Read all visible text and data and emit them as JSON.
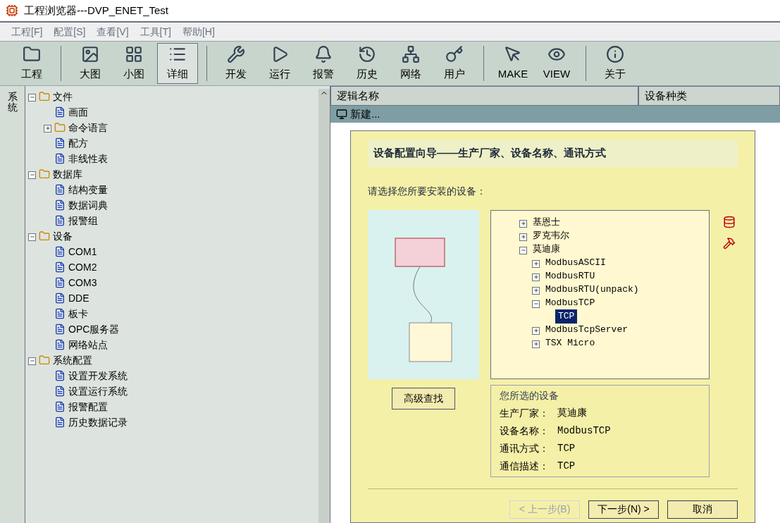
{
  "window": {
    "title": "工程浏览器---DVP_ENET_Test"
  },
  "menu": [
    "工程[F]",
    "配置[S]",
    "查看[V]",
    "工具[T]",
    "帮助[H]"
  ],
  "toolbar": [
    {
      "label": "工程",
      "selected": false
    },
    {
      "label": "大图",
      "selected": false
    },
    {
      "label": "小图",
      "selected": false
    },
    {
      "label": "详细",
      "selected": true
    },
    {
      "label": "开发",
      "selected": false
    },
    {
      "label": "运行",
      "selected": false
    },
    {
      "label": "报警",
      "selected": false
    },
    {
      "label": "历史",
      "selected": false
    },
    {
      "label": "网络",
      "selected": false
    },
    {
      "label": "用户",
      "selected": false
    },
    {
      "label": "MAKE",
      "selected": false
    },
    {
      "label": "VIEW",
      "selected": false
    },
    {
      "label": "关于",
      "selected": false
    }
  ],
  "side_tab": "系统",
  "tree": [
    {
      "label": "文件",
      "expanded": true,
      "children": [
        {
          "label": "画面"
        },
        {
          "label": "命令语言",
          "expanded": false
        },
        {
          "label": "配方"
        },
        {
          "label": "非线性表"
        }
      ]
    },
    {
      "label": "数据库",
      "expanded": true,
      "children": [
        {
          "label": "结构变量"
        },
        {
          "label": "数据词典"
        },
        {
          "label": "报警组"
        }
      ]
    },
    {
      "label": "设备",
      "expanded": true,
      "children": [
        {
          "label": "COM1"
        },
        {
          "label": "COM2"
        },
        {
          "label": "COM3"
        },
        {
          "label": "DDE"
        },
        {
          "label": "板卡"
        },
        {
          "label": "OPC服务器"
        },
        {
          "label": "网络站点"
        }
      ]
    },
    {
      "label": "系统配置",
      "expanded": true,
      "children": [
        {
          "label": "设置开发系统"
        },
        {
          "label": "设置运行系统"
        },
        {
          "label": "报警配置"
        },
        {
          "label": "历史数据记录"
        }
      ]
    }
  ],
  "list": {
    "columns": [
      "逻辑名称",
      "设备种类"
    ],
    "rows": [
      {
        "name": "新建..."
      }
    ]
  },
  "dialog": {
    "title": "设备配置向导——生产厂家、设备名称、通讯方式",
    "instruction": "请选择您所要安装的设备：",
    "tree": [
      {
        "label": "基恩士",
        "expanded": false,
        "selected": false
      },
      {
        "label": "罗克韦尔",
        "expanded": false,
        "selected": false
      },
      {
        "label": "莫迪康",
        "expanded": true,
        "selected": false,
        "children": [
          {
            "label": "ModbusASCII",
            "expanded": false,
            "selected": false
          },
          {
            "label": "ModbusRTU",
            "expanded": false,
            "selected": false
          },
          {
            "label": "ModbusRTU(unpack)",
            "expanded": false,
            "selected": false
          },
          {
            "label": "ModbusTCP",
            "expanded": true,
            "selected": false,
            "children": [
              {
                "label": "TCP",
                "selected": true
              }
            ]
          },
          {
            "label": "ModbusTcpServer",
            "expanded": false,
            "selected": false
          },
          {
            "label": "TSX Micro",
            "expanded": false,
            "selected": false
          }
        ]
      }
    ],
    "info_title": "您所选的设备",
    "info": [
      {
        "label": "生产厂家：",
        "value": "莫迪康"
      },
      {
        "label": "设备名称：",
        "value": "ModbusTCP"
      },
      {
        "label": "通讯方式：",
        "value": "TCP"
      },
      {
        "label": "通信描述：",
        "value": "TCP"
      }
    ],
    "search_button": "高级查找",
    "buttons": [
      {
        "label": "< 上一步(B)",
        "disabled": true
      },
      {
        "label": "下一步(N) >",
        "disabled": false
      },
      {
        "label": "取消",
        "disabled": false
      }
    ]
  }
}
